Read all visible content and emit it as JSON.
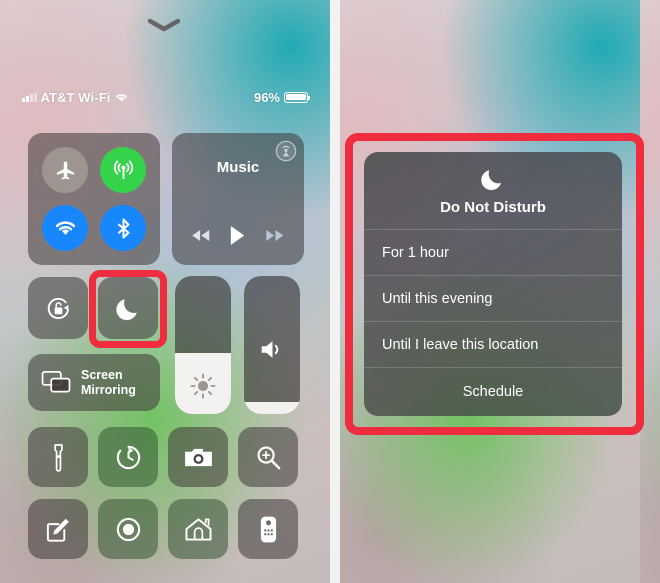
{
  "status_bar": {
    "carrier": "AT&T Wi-Fi",
    "battery_percent": "96%",
    "signal_icon": "cellular-bars-icon",
    "wifi_icon": "wifi-icon",
    "battery_icon": "battery-icon"
  },
  "grabber": {
    "icon": "chevron-down-icon"
  },
  "control_center": {
    "connectivity": {
      "airplane": {
        "label": "Airplane Mode",
        "icon": "airplane-icon",
        "state": "off",
        "color": "#a09893"
      },
      "cellular": {
        "label": "Cellular Data",
        "icon": "cellular-data-icon",
        "state": "on",
        "color": "#35d24c"
      },
      "wifi": {
        "label": "Wi-Fi",
        "icon": "wifi-icon",
        "state": "on",
        "color": "#1787fb"
      },
      "bluetooth": {
        "label": "Bluetooth",
        "icon": "bluetooth-icon",
        "state": "on",
        "color": "#1787fb"
      }
    },
    "music": {
      "title": "Music",
      "airplay_icon": "airplay-icon",
      "rewind_icon": "rewind-icon",
      "play_icon": "play-icon",
      "forward_icon": "fast-forward-icon"
    },
    "rotation_lock": {
      "label": "Rotation Lock",
      "icon": "rotation-lock-icon"
    },
    "do_not_disturb": {
      "label": "Do Not Disturb",
      "icon": "moon-icon",
      "highlighted": true
    },
    "screen_mirroring": {
      "line1": "Screen",
      "line2": "Mirroring",
      "icon": "screen-mirroring-icon"
    },
    "brightness": {
      "label": "Brightness",
      "icon": "brightness-icon",
      "value_percent": 44
    },
    "volume": {
      "label": "Volume",
      "icon": "volume-icon",
      "value_percent": 9
    },
    "shortcuts": [
      {
        "label": "Flashlight",
        "icon": "flashlight-icon"
      },
      {
        "label": "Timer",
        "icon": "timer-icon"
      },
      {
        "label": "Camera",
        "icon": "camera-icon"
      },
      {
        "label": "Magnifier",
        "icon": "magnifier-icon"
      },
      {
        "label": "Notes",
        "icon": "notes-icon"
      },
      {
        "label": "Screen Recording",
        "icon": "record-icon"
      },
      {
        "label": "Home",
        "icon": "home-icon"
      },
      {
        "label": "Apple TV Remote",
        "icon": "remote-icon"
      }
    ]
  },
  "dnd_menu": {
    "icon": "moon-icon",
    "title": "Do Not Disturb",
    "options": [
      {
        "label": "For 1 hour"
      },
      {
        "label": "Until this evening"
      },
      {
        "label": "Until I leave this location"
      },
      {
        "label": "Schedule"
      }
    ]
  },
  "annotations": {
    "highlight_color": "#ef2d3e",
    "dnd_button_box": "red-highlight-box",
    "dnd_menu_box": "red-highlight-box"
  }
}
